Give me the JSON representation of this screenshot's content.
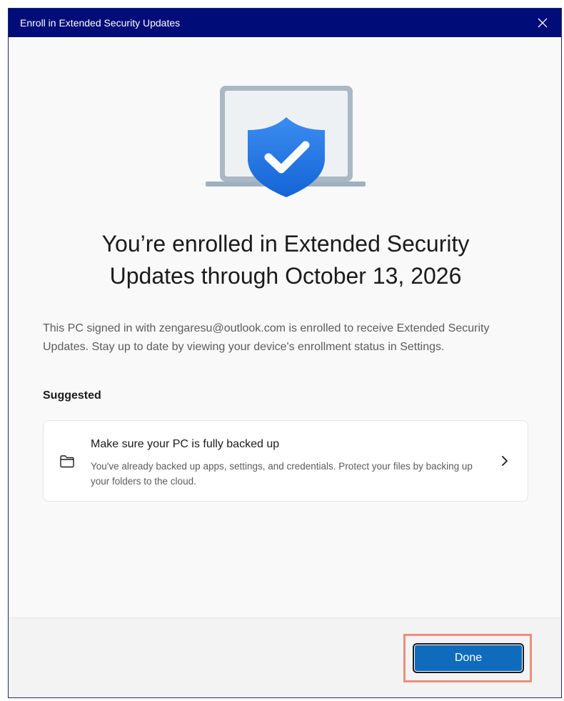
{
  "window": {
    "title": "Enroll in Extended Security Updates",
    "close_icon": "close-icon"
  },
  "hero": {
    "icon": "laptop-shield-check-icon"
  },
  "headline": {
    "line1": "You’re enrolled in Extended Security",
    "line2": "Updates through October 13, 2026"
  },
  "description": "This PC signed in with zengaresu@outlook.com is enrolled to receive Extended Security Updates. Stay up to date by viewing your device's enrollment status in Settings.",
  "suggested": {
    "label": "Suggested",
    "card": {
      "icon": "folder-icon",
      "title": "Make sure your PC is fully backed up",
      "description": "You've already backed up apps, settings, and credentials. Protect your files by backing up your folders to the cloud.",
      "chevron": "chevron-right-icon"
    }
  },
  "footer": {
    "done_label": "Done"
  },
  "colors": {
    "titlebar": "#000c78",
    "accent": "#0f6cbd",
    "highlight": "#e8907c"
  }
}
